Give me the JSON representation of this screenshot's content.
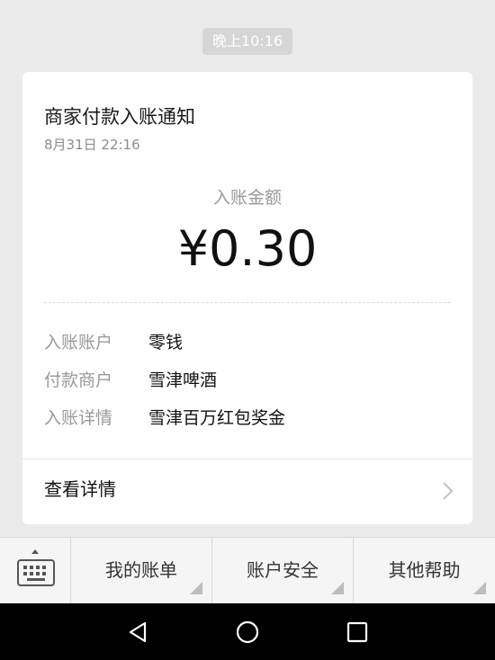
{
  "chat": {
    "timestamp": "晚上10:16"
  },
  "card": {
    "title": "商家付款入账通知",
    "date": "8月31日  22:16",
    "amount_label": "入账金额",
    "amount": "¥0.30",
    "details": [
      {
        "key": "入账账户",
        "value": "零钱"
      },
      {
        "key": "付款商户",
        "value": "雪津啤酒"
      },
      {
        "key": "入账详情",
        "value": "雪津百万红包奖金"
      }
    ],
    "view_detail_label": "查看详情"
  },
  "menu": {
    "keyboard_icon": "keyboard-icon",
    "items": [
      {
        "label": "我的账单"
      },
      {
        "label": "账户安全"
      },
      {
        "label": "其他帮助"
      }
    ]
  },
  "system_nav": {
    "buttons": [
      "back-icon",
      "home-icon",
      "recent-apps-icon"
    ]
  },
  "colors": {
    "background": "#ebebeb",
    "card": "#ffffff",
    "muted_text": "#9a9a9a",
    "nav_bar": "#000000"
  }
}
